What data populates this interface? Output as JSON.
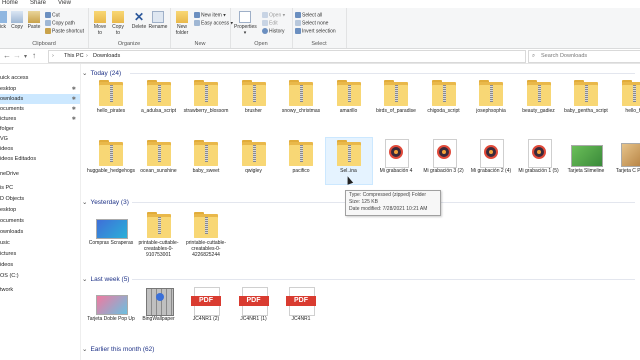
{
  "ribbon_tabs": [
    "Home",
    "Share",
    "View"
  ],
  "ribbon": {
    "clipboard": {
      "label": "Clipboard",
      "pin_label": "ick",
      "copy": "Copy",
      "paste": "Paste",
      "cut": "Cut",
      "copy_path": "Copy path",
      "paste_shortcut": "Paste shortcut"
    },
    "organize": {
      "label": "Organize",
      "move_to": "Move to",
      "copy_to": "Copy to",
      "delete": "Delete",
      "rename": "Rename"
    },
    "new": {
      "label": "New",
      "new_folder": "New folder",
      "new_item": "New item",
      "easy_access": "Easy access"
    },
    "open": {
      "label": "Open",
      "properties": "Properties",
      "open": "Open",
      "edit": "Edit",
      "history": "History"
    },
    "select": {
      "label": "Select",
      "select_all": "Select all",
      "select_none": "Select none",
      "invert_selection": "Invert selection"
    }
  },
  "address": {
    "path": [
      "This PC",
      "Downloads"
    ],
    "search_placeholder": "Search Downloads"
  },
  "nav_items": [
    {
      "label": "uick access",
      "pinned": false
    },
    {
      "label": "esktop",
      "pinned": true
    },
    {
      "label": "ownloads",
      "pinned": true,
      "selected": true
    },
    {
      "label": "ocuments",
      "pinned": true
    },
    {
      "label": "ictures",
      "pinned": true
    },
    {
      "label": "folger",
      "pinned": false
    },
    {
      "label": "VG",
      "pinned": false
    },
    {
      "label": "ideos",
      "pinned": false
    },
    {
      "label": "ideos Editados",
      "pinned": false
    },
    {
      "label": "neDrive",
      "pinned": false
    },
    {
      "label": "is PC",
      "pinned": false
    },
    {
      "label": "D Objects",
      "pinned": false
    },
    {
      "label": "esktop",
      "pinned": false
    },
    {
      "label": "ocuments",
      "pinned": false
    },
    {
      "label": "ownloads",
      "pinned": false
    },
    {
      "label": "usic",
      "pinned": false
    },
    {
      "label": "ictures",
      "pinned": false
    },
    {
      "label": "ideos",
      "pinned": false
    },
    {
      "label": "OS (C:)",
      "pinned": false
    },
    {
      "label": "twork",
      "pinned": false
    }
  ],
  "groups": {
    "today": {
      "title": "Today (24)",
      "row1": [
        {
          "name": "hello_pirates",
          "type": "zip"
        },
        {
          "name": "a_adulsa_script",
          "type": "zip"
        },
        {
          "name": "strawberry_blossom",
          "type": "zip"
        },
        {
          "name": "brusher",
          "type": "zip"
        },
        {
          "name": "snowy_christmas",
          "type": "zip"
        },
        {
          "name": "amarillo",
          "type": "zip"
        },
        {
          "name": "birds_of_paradise",
          "type": "zip"
        },
        {
          "name": "chigoda_script",
          "type": "zip"
        },
        {
          "name": "josephsophia",
          "type": "zip"
        },
        {
          "name": "beauty_gadiez",
          "type": "zip"
        },
        {
          "name": "baby_gentha_script",
          "type": "zip"
        },
        {
          "name": "hello_h",
          "type": "zip"
        }
      ],
      "row2": [
        {
          "name": "huggable_hedgehogs",
          "type": "zip"
        },
        {
          "name": "ocean_sunshine",
          "type": "zip"
        },
        {
          "name": "baby_sweet",
          "type": "zip"
        },
        {
          "name": "qwigley",
          "type": "zip"
        },
        {
          "name": "pacifico",
          "type": "zip"
        },
        {
          "name": "Sel..ina",
          "type": "zip"
        },
        {
          "name": "Mi grabación 4",
          "type": "audio"
        },
        {
          "name": "Mi grabación 3 (2)",
          "type": "audio"
        },
        {
          "name": "Mi grabación 2 (4)",
          "type": "audio"
        },
        {
          "name": "Mi grabación 1 (5)",
          "type": "audio"
        },
        {
          "name": "Tarjeta Slimeline",
          "type": "img1"
        },
        {
          "name": "Tarjeta C Pop U",
          "type": "img2"
        }
      ]
    },
    "yesterday": {
      "title": "Yesterday (3)",
      "items": [
        {
          "name": "Compras Scraperas",
          "type": "img3"
        },
        {
          "name": "printable-cuttable-creatables-0-910753001",
          "type": "zip"
        },
        {
          "name": "printable-cuttable-creatables-0-4226825244",
          "type": "zip"
        }
      ]
    },
    "last_week": {
      "title": "Last week (5)",
      "items": [
        {
          "name": "Tarjeta Doble Pop Up",
          "type": "img4"
        },
        {
          "name": "BingWallpaper",
          "type": "winzip"
        },
        {
          "name": "JC4NR1 (2)",
          "type": "pdf"
        },
        {
          "name": "JC4NR1 (1)",
          "type": "pdf"
        },
        {
          "name": "JC4NR1",
          "type": "pdf"
        }
      ]
    },
    "earlier": {
      "title": "Earlier this month (62)"
    }
  },
  "pdf_label": "PDF",
  "tooltip": {
    "type": "Type: Compressed (zipped) Folder",
    "size": "Size: 125 KB",
    "date": "Date modified: 7/28/2021 10:21 AM"
  },
  "colors": {
    "accent": "#1e3287",
    "selected": "#cce8ff",
    "folder": "#f8d775",
    "pdf": "#d93b30"
  }
}
